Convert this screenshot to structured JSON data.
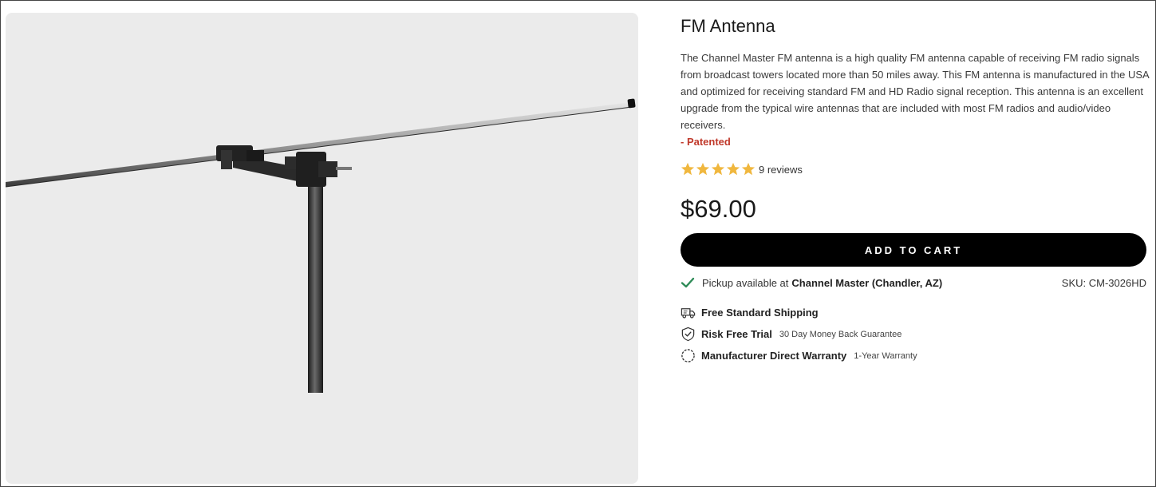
{
  "product": {
    "title": "FM Antenna",
    "description": "The Channel Master FM antenna is a high quality FM antenna capable of receiving FM radio signals from broadcast towers located more than 50 miles away.  This FM antenna is manufactured in the USA and optimized for receiving standard FM and HD Radio signal reception. This antenna is an excellent upgrade from the typical wire antennas that are included with most FM radios and audio/video receivers.",
    "patented": "- Patented",
    "rating": 5,
    "reviews": "9 reviews",
    "price": "$69.00",
    "add_to_cart": "ADD TO CART",
    "pickup_text": "Pickup available at",
    "pickup_location": "Channel Master (Chandler, AZ)",
    "sku": "SKU: CM-3026HD"
  },
  "features": [
    {
      "icon": "shipping-truck-icon",
      "title": "Free Standard Shipping",
      "subtitle": ""
    },
    {
      "icon": "shield-check-icon",
      "title": "Risk Free Trial",
      "subtitle": "30 Day Money Back Guarantee"
    },
    {
      "icon": "warranty-badge-icon",
      "title": "Manufacturer Direct Warranty",
      "subtitle": "1-Year Warranty"
    }
  ],
  "colors": {
    "star": "#f0b73e",
    "check": "#2e8b57",
    "patented": "#c0392b",
    "button": "#000000",
    "image_bg": "#ebebeb"
  }
}
